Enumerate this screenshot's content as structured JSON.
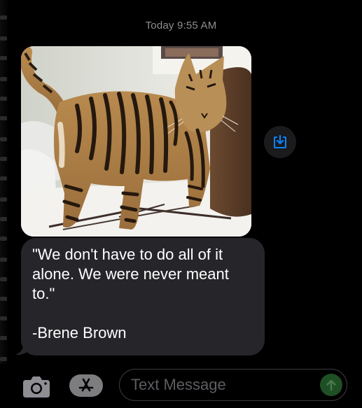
{
  "conversation": {
    "timestamp": "Today 9:55 AM"
  },
  "messages": [
    {
      "type": "image",
      "description_icon": "cat-photo",
      "save_icon": "save-to-files-icon"
    },
    {
      "type": "text",
      "lines": [
        "\"We don't have to do all of it",
        "alone. We were never meant",
        "to.\"",
        "",
        "-Brene Brown"
      ]
    }
  ],
  "composer": {
    "camera_icon": "camera-icon",
    "apps_icon": "app-store-icon",
    "placeholder": "Text Message",
    "send_icon": "send-arrow-icon"
  },
  "colors": {
    "background": "#000000",
    "bubble": "#26252a",
    "timestamp": "#8e8e93",
    "accent_blue": "#0a84ff",
    "send_green": "#1f4f24"
  }
}
